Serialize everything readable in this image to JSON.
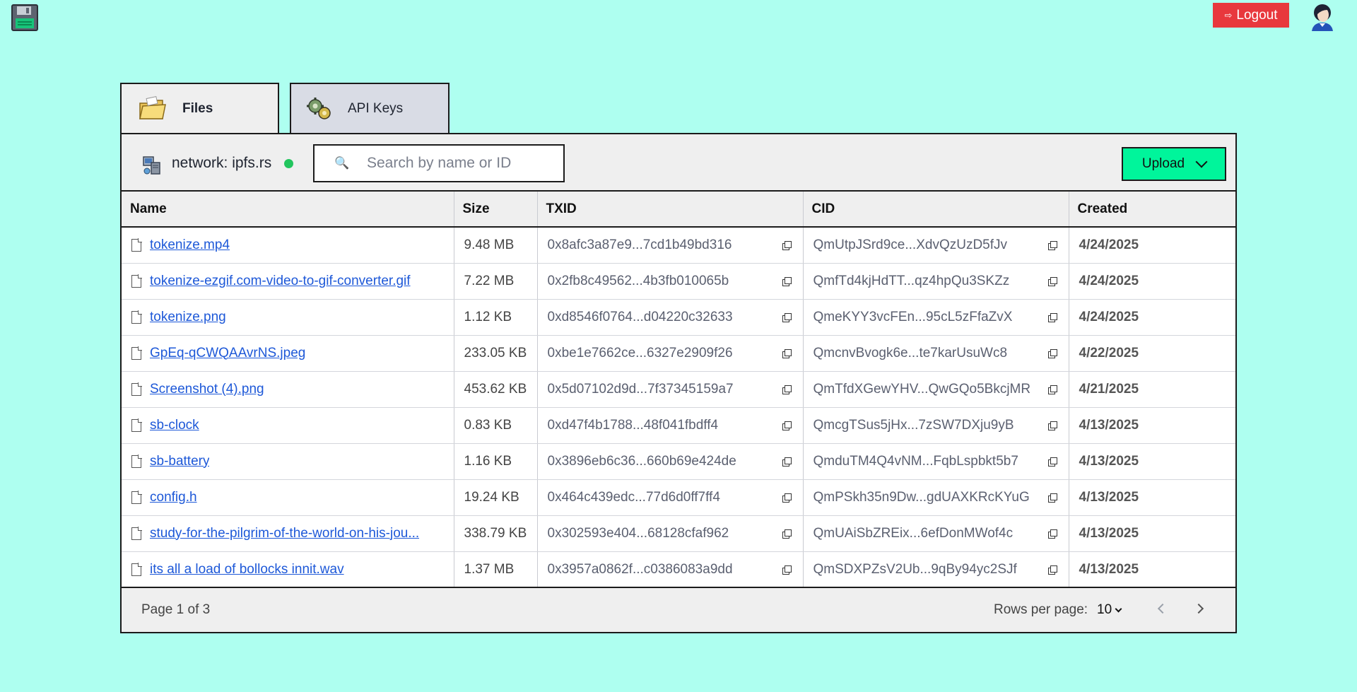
{
  "header": {
    "logo_icon": "floppy-disk-icon",
    "logout_label": "Logout",
    "logout_icon": "logout-icon",
    "avatar_icon": "user-avatar-icon",
    "logout_color": "#e8383d"
  },
  "tabs": [
    {
      "label": "Files",
      "icon": "folder-icon",
      "active": true
    },
    {
      "label": "API Keys",
      "icon": "gears-icon",
      "active": false
    }
  ],
  "toolbar": {
    "network_label": "network: ipfs.rs",
    "network_status_color": "#22c55e",
    "search_placeholder": "Search by name or ID",
    "upload_label": "Upload",
    "upload_color": "#00f59b"
  },
  "table": {
    "columns": [
      "Name",
      "Size",
      "TXID",
      "CID",
      "Created"
    ],
    "rows": [
      {
        "name": "tokenize.mp4",
        "size": "9.48 MB",
        "txid": "0x8afc3a87e9...7cd1b49bd316",
        "cid": "QmUtpJSrd9ce...XdvQzUzD5fJv",
        "created": "4/24/2025"
      },
      {
        "name": "tokenize-ezgif.com-video-to-gif-converter.gif",
        "size": "7.22 MB",
        "txid": "0x2fb8c49562...4b3fb010065b",
        "cid": "QmfTd4kjHdTT...qz4hpQu3SKZz",
        "created": "4/24/2025"
      },
      {
        "name": "tokenize.png",
        "size": "1.12 KB",
        "txid": "0xd8546f0764...d04220c32633",
        "cid": "QmeKYY3vcFEn...95cL5zFfaZvX",
        "created": "4/24/2025"
      },
      {
        "name": "GpEq-qCWQAAvrNS.jpeg",
        "size": "233.05 KB",
        "txid": "0xbe1e7662ce...6327e2909f26",
        "cid": "QmcnvBvogk6e...te7karUsuWc8",
        "created": "4/22/2025"
      },
      {
        "name": "Screenshot (4).png",
        "size": "453.62 KB",
        "txid": "0x5d07102d9d...7f37345159a7",
        "cid": "QmTfdXGewYHV...QwGQo5BkcjMR",
        "created": "4/21/2025"
      },
      {
        "name": "sb-clock",
        "size": "0.83 KB",
        "txid": "0xd47f4b1788...48f041fbdff4",
        "cid": "QmcgTSus5jHx...7zSW7DXju9yB",
        "created": "4/13/2025"
      },
      {
        "name": "sb-battery",
        "size": "1.16 KB",
        "txid": "0x3896eb6c36...660b69e424de",
        "cid": "QmduTM4Q4vNM...FqbLspbkt5b7",
        "created": "4/13/2025"
      },
      {
        "name": "config.h",
        "size": "19.24 KB",
        "txid": "0x464c439edc...77d6d0ff7ff4",
        "cid": "QmPSkh35n9Dw...gdUAXKRcKYuG",
        "created": "4/13/2025"
      },
      {
        "name": "study-for-the-pilgrim-of-the-world-on-his-jou...",
        "size": "338.79 KB",
        "txid": "0x302593e404...68128cfaf962",
        "cid": "QmUAiSbZREix...6efDonMWof4c",
        "created": "4/13/2025"
      },
      {
        "name": "its all a load of bollocks innit.wav",
        "size": "1.37 MB",
        "txid": "0x3957a0862f...c0386083a9dd",
        "cid": "QmSDXPZsV2Ub...9qBy94yc2SJf",
        "created": "4/13/2025"
      }
    ]
  },
  "footer": {
    "page_text": "Page 1 of 3",
    "rows_label": "Rows per page:",
    "rows_value": "10"
  },
  "colors": {
    "background": "#aefff0",
    "link": "#1d58d8"
  }
}
